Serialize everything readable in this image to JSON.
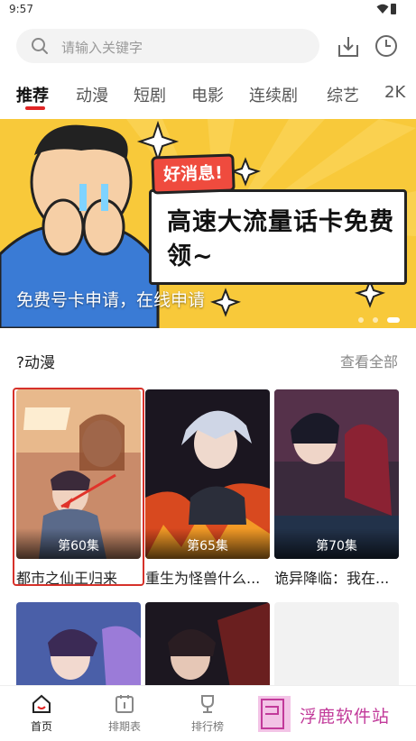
{
  "status": {
    "time": "9:57"
  },
  "search": {
    "placeholder": "请输入关键字"
  },
  "tabs": [
    {
      "label": "推荐",
      "active": true
    },
    {
      "label": "动漫"
    },
    {
      "label": "短剧"
    },
    {
      "label": "电影"
    },
    {
      "label": "连续剧"
    },
    {
      "label": "综艺"
    },
    {
      "label": "2K"
    }
  ],
  "banner": {
    "tag": "好消息!",
    "headline": "高速大流量话卡免费领~",
    "caption": "免费号卡申请，在线申请"
  },
  "section": {
    "title": "?动漫",
    "more": "查看全部"
  },
  "items": [
    {
      "episode": "第60集",
      "title": "都市之仙王归来"
    },
    {
      "episode": "第65集",
      "title": "重生为怪兽什么..."
    },
    {
      "episode": "第70集",
      "title": "诡异降临：我在..."
    }
  ],
  "nav": [
    {
      "label": "首页",
      "icon": "home-icon",
      "active": true
    },
    {
      "label": "排期表",
      "icon": "calendar-icon"
    },
    {
      "label": "排行榜",
      "icon": "trophy-icon"
    }
  ],
  "watermark": {
    "text": "浮鹿软件站"
  },
  "colors": {
    "accent": "#e02424",
    "banner_bg": "#f8c93a",
    "highlight": "#d6312a"
  }
}
